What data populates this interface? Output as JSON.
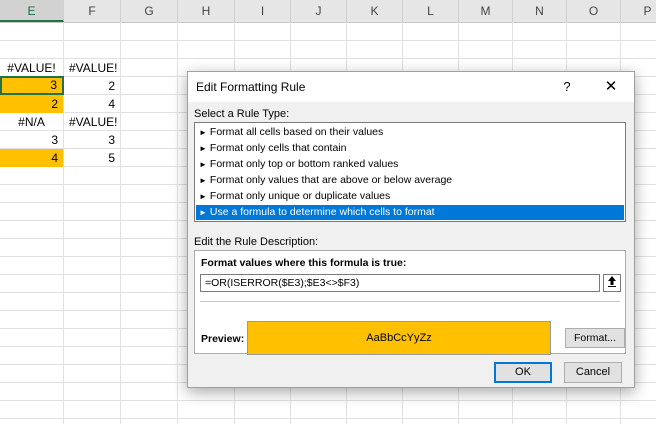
{
  "sheet": {
    "columns": [
      "E",
      "F",
      "G",
      "H",
      "I",
      "J",
      "K",
      "L",
      "M",
      "N",
      "O",
      "P"
    ],
    "selected_column": "E",
    "rows": [
      {
        "e": "#VALUE!",
        "f": "#VALUE!"
      },
      {
        "e": "3",
        "f": "2"
      },
      {
        "e": "2",
        "f": "4"
      },
      {
        "e": "#N/A",
        "f": "#VALUE!"
      },
      {
        "e": "3",
        "f": "3"
      },
      {
        "e": "4",
        "f": "5"
      }
    ],
    "highlight_color": "#ffc000"
  },
  "dialog": {
    "title": "Edit Formatting Rule",
    "help_label": "?",
    "close_label": "✕",
    "select_rule_type_label": "Select a Rule Type:",
    "rule_types": [
      "Format all cells based on their values",
      "Format only cells that contain",
      "Format only top or bottom ranked values",
      "Format only values that are above or below average",
      "Format only unique or duplicate values",
      "Use a formula to determine which cells to format"
    ],
    "selected_rule_index": 5,
    "edit_description_label": "Edit the Rule Description:",
    "formula_title": "Format values where this formula is true:",
    "formula_value": "=OR(ISERROR($E3);$E3<>$F3)",
    "preview_label": "Preview:",
    "preview_text": "AaBbCcYyZz",
    "preview_color": "#ffc000",
    "format_button": "Format...",
    "ok_button": "OK",
    "cancel_button": "Cancel",
    "accent_color": "#0078d7"
  }
}
